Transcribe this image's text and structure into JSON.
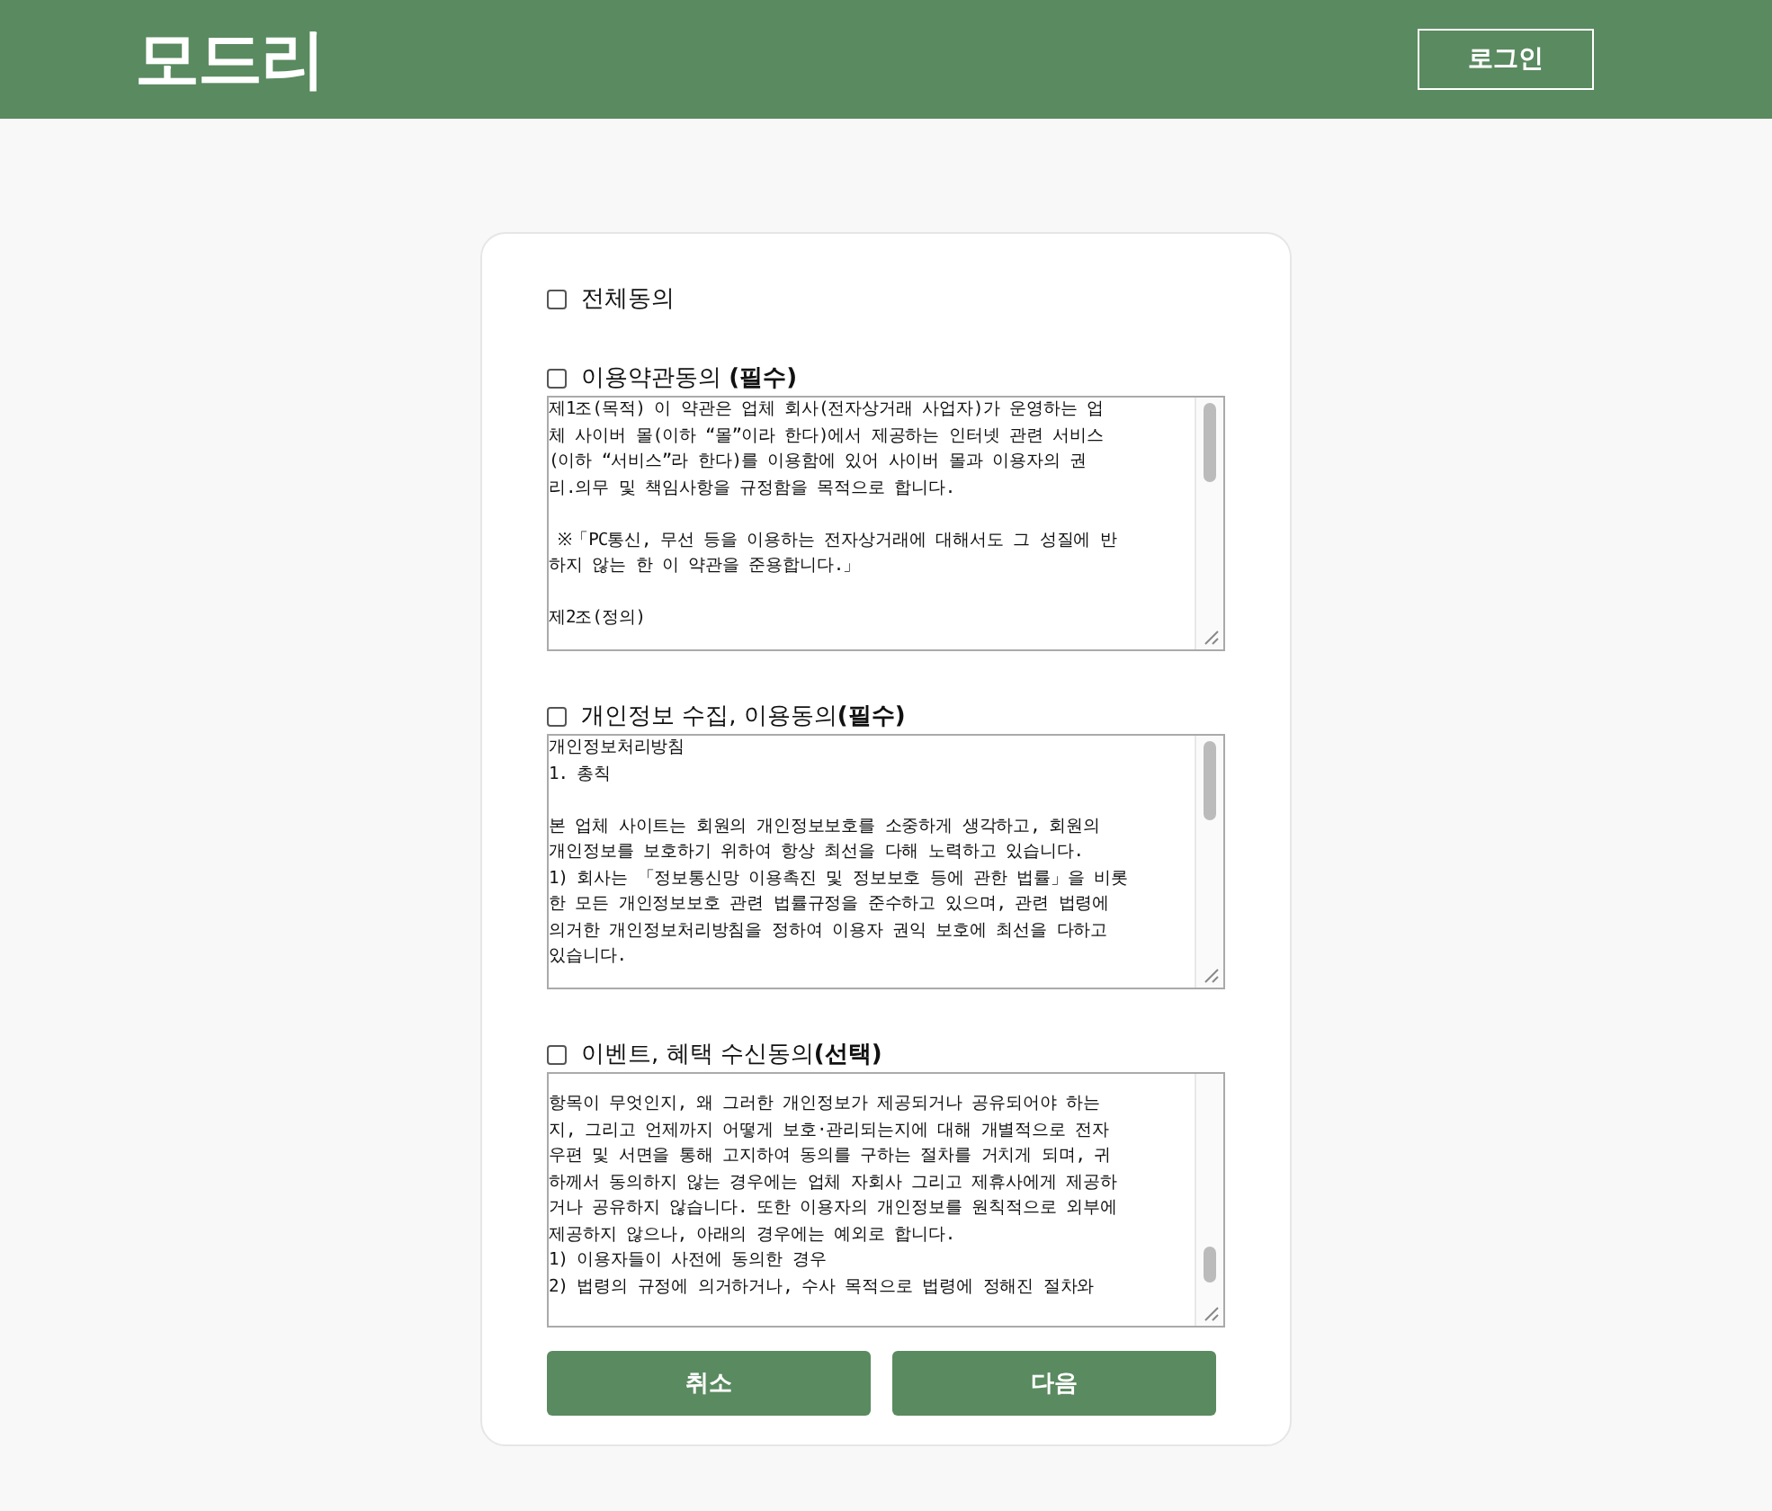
{
  "header": {
    "logo": "모드리",
    "login_button": "로그인"
  },
  "agree_all": {
    "label": "전체동의",
    "checked": false
  },
  "sections": [
    {
      "label": "이용약관동의 **(필수)**",
      "checked": false,
      "scrolled_to_end": false,
      "paragraphs": [
        [
          "제1조(목적) 이 약관은 업체 회사(전자상거래 사업자)가 운영하는 업",
          "체 사이버 몰(이하 “몰”이라 한다)에서 제공하는 인터넷 관련 서비스",
          "(이하 “서비스”라 한다)를 이용함에 있어 사이버 몰과 이용자의 권",
          "리.의무 및 책임사항을 규정함을 목적으로 합니다."
        ],
        [
          " ※「PC통신, 무선 등을 이용하는 전자상거래에 대해서도 그 성질에 반",
          "하지 않는 한 이 약관을 준용합니다.」"
        ],
        [
          "제2조(정의)"
        ]
      ]
    },
    {
      "label": "개인정보 수집, 이용동의**(필수)**",
      "checked": false,
      "scrolled_to_end": false,
      "paragraphs": [
        [
          "개인정보처리방침",
          "1. 총칙"
        ],
        [
          "본 업체 사이트는 회원의 개인정보보호를 소중하게 생각하고, 회원의",
          "개인정보를 보호하기 위하여 항상 최선을 다해 노력하고 있습니다.",
          "1) 회사는 「정보통신망 이용촉진 및 정보보호 등에 관한 법률」을 비롯",
          "한 모든 개인정보보호 관련 법률규정을 준수하고 있으며, 관련 법령에",
          "의거한 개인정보처리방침을 정하여 이용자 권익 보호에 최선을 다하고",
          "있습니다."
        ]
      ]
    },
    {
      "label": "이벤트, 혜택 수신동의**(선택)**",
      "checked": false,
      "scrolled_to_end": true,
      "paragraphs": [
        [
          "항목이 무엇인지, 왜 그러한 개인정보가 제공되거나 공유되어야 하는",
          "지, 그리고 언제까지 어떻게 보호·관리되는지에 대해 개별적으로 전자",
          "우편 및 서면을 통해 고지하여 동의를 구하는 절차를 거치게 되며, 귀",
          "하께서 동의하지 않는 경우에는 업체 자회사 그리고 제휴사에게 제공하",
          "거나 공유하지 않습니다. 또한 이용자의 개인정보를 원칙적으로 외부에",
          "제공하지 않으나, 아래의 경우에는 예외로 합니다.",
          "1) 이용자들이 사전에 동의한 경우",
          "2) 법령의 규정에 의거하거나, 수사 목적으로 법령에 정해진 절차와"
        ]
      ]
    }
  ],
  "buttons": [
    "취소",
    "다음"
  ]
}
